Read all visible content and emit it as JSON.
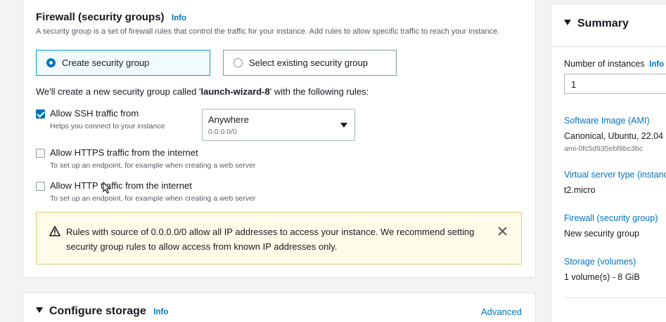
{
  "firewall": {
    "title": "Firewall (security groups)",
    "info": "Info",
    "description": "A security group is a set of firewall rules that control the traffic for your instance. Add rules to allow specific traffic to reach your instance.",
    "options": {
      "create": "Create security group",
      "select": "Select existing security group"
    },
    "selected_option": "create",
    "notice_prefix": "We'll create a new security group called '",
    "group_name": "launch-wizard-8",
    "notice_suffix": "' with the following rules:",
    "rules": [
      {
        "label": "Allow SSH traffic from",
        "sub": "Helps you connect to your instance",
        "checked": true
      },
      {
        "label": "Allow HTTPS traffic from the internet",
        "sub": "To set up an endpoint, for example when creating a web server",
        "checked": false
      },
      {
        "label": "Allow HTTP traffic from the internet",
        "sub": "To set up an endpoint, for example when creating a web server",
        "checked": false
      }
    ],
    "ssh_source": {
      "value": "Anywhere",
      "sub": "0.0.0.0/0"
    },
    "warning": "Rules with source of 0.0.0.0/0 allow all IP addresses to access your instance. We recommend setting security group rules to allow access from known IP addresses only."
  },
  "storage": {
    "title": "Configure storage",
    "info": "Info",
    "advanced": "Advanced"
  },
  "summary": {
    "title": "Summary",
    "instances_label": "Number of instances",
    "instances_info": "Info",
    "instances_value": "1",
    "ami_label": "Software Image (AMI)",
    "ami_value": "Canonical, Ubuntu, 22.04",
    "ami_id": "ami-0fc5d935ebf8bc3bc",
    "type_label": "Virtual server type (instance type)",
    "type_value": "t2.micro",
    "firewall_label": "Firewall (security group)",
    "firewall_value": "New security group",
    "storage_label": "Storage (volumes)",
    "storage_value": "1 volume(s) - 8 GiB"
  },
  "colors": {
    "accent": "#0073bb",
    "warning_bg": "#fffce9",
    "selected_tile_bg": "#f1faff"
  }
}
